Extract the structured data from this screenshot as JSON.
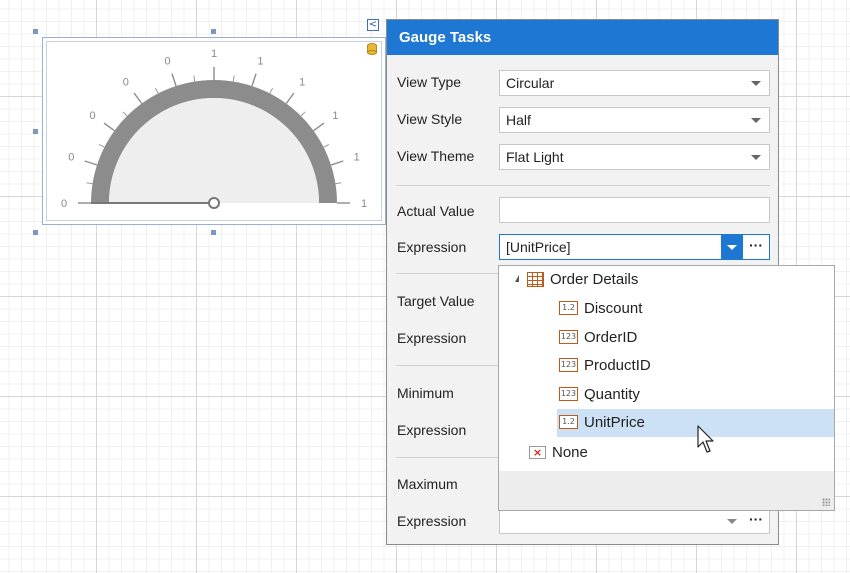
{
  "gauge": {
    "scale_labels": [
      "0",
      "0",
      "0",
      "0",
      "0",
      "1",
      "1",
      "1",
      "1",
      "1",
      "1"
    ]
  },
  "smart_tag_glyph": "<",
  "panel": {
    "title": "Gauge Tasks",
    "view_type": {
      "label": "View Type",
      "value": "Circular"
    },
    "view_style": {
      "label": "View Style",
      "value": "Half"
    },
    "view_theme": {
      "label": "View Theme",
      "value": "Flat Light"
    },
    "actual_value": {
      "label": "Actual Value",
      "value": ""
    },
    "actual_expression": {
      "label": "Expression",
      "value": "[UnitPrice]"
    },
    "target_value": {
      "label": "Target Value"
    },
    "target_expression": {
      "label": "Expression"
    },
    "minimum": {
      "label": "Minimum"
    },
    "minimum_expression": {
      "label": "Expression"
    },
    "maximum": {
      "label": "Maximum"
    },
    "maximum_expression": {
      "label": "Expression",
      "value": ""
    },
    "ellipsis": "···"
  },
  "popup": {
    "root": "Order Details",
    "fields": [
      {
        "name": "Discount",
        "type": "1.2"
      },
      {
        "name": "OrderID",
        "type": "123"
      },
      {
        "name": "ProductID",
        "type": "123"
      },
      {
        "name": "Quantity",
        "type": "123"
      },
      {
        "name": "UnitPrice",
        "type": "1.2",
        "selected": true
      }
    ],
    "none_label": "None",
    "none_glyph": "×"
  },
  "colors": {
    "accent": "#1e77d3",
    "selection": "#cce0f6",
    "field_icon_border": "#c05a1a"
  }
}
